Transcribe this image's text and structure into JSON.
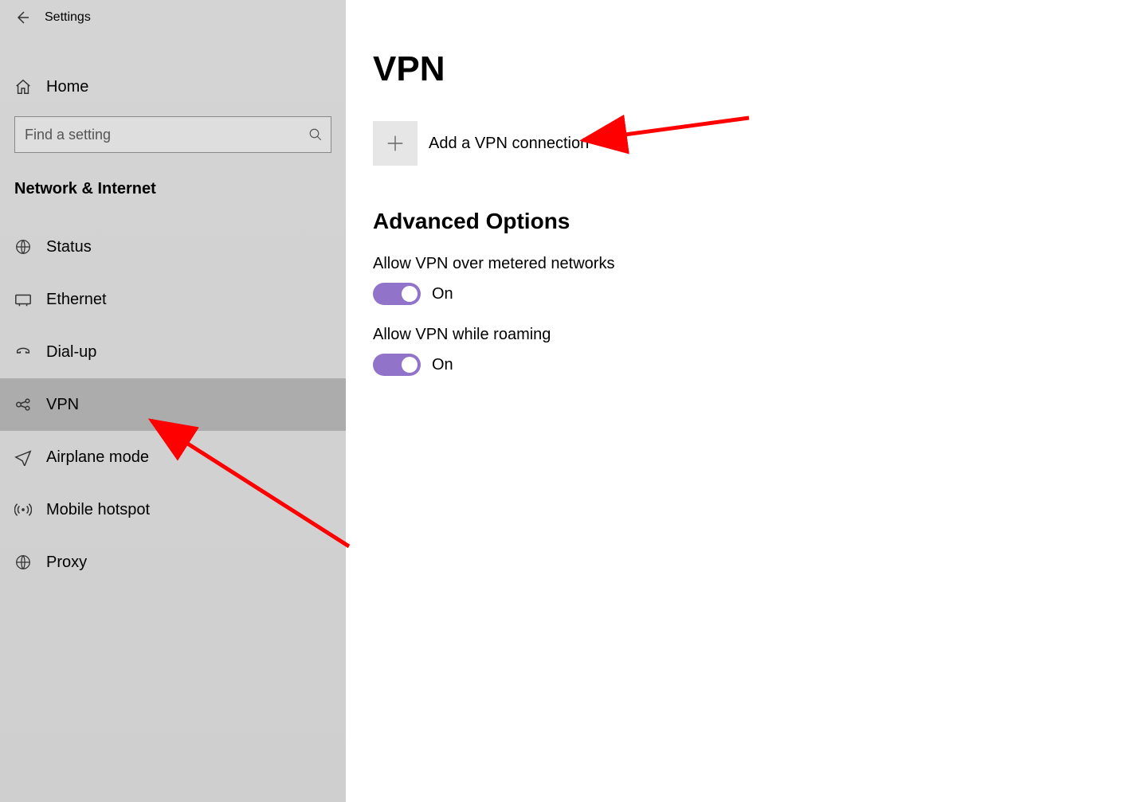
{
  "header": {
    "title": "Settings"
  },
  "home_label": "Home",
  "search": {
    "placeholder": "Find a setting"
  },
  "category": "Network & Internet",
  "nav": {
    "items": [
      {
        "label": "Status"
      },
      {
        "label": "Ethernet"
      },
      {
        "label": "Dial-up"
      },
      {
        "label": "VPN"
      },
      {
        "label": "Airplane mode"
      },
      {
        "label": "Mobile hotspot"
      },
      {
        "label": "Proxy"
      }
    ],
    "selected_index": 3
  },
  "main": {
    "page_title": "VPN",
    "add_label": "Add a VPN connection",
    "advanced_title": "Advanced Options",
    "options": [
      {
        "label": "Allow VPN over metered networks",
        "state": "On",
        "value": true
      },
      {
        "label": "Allow VPN while roaming",
        "state": "On",
        "value": true
      }
    ]
  },
  "accent_color": "#9173c9"
}
